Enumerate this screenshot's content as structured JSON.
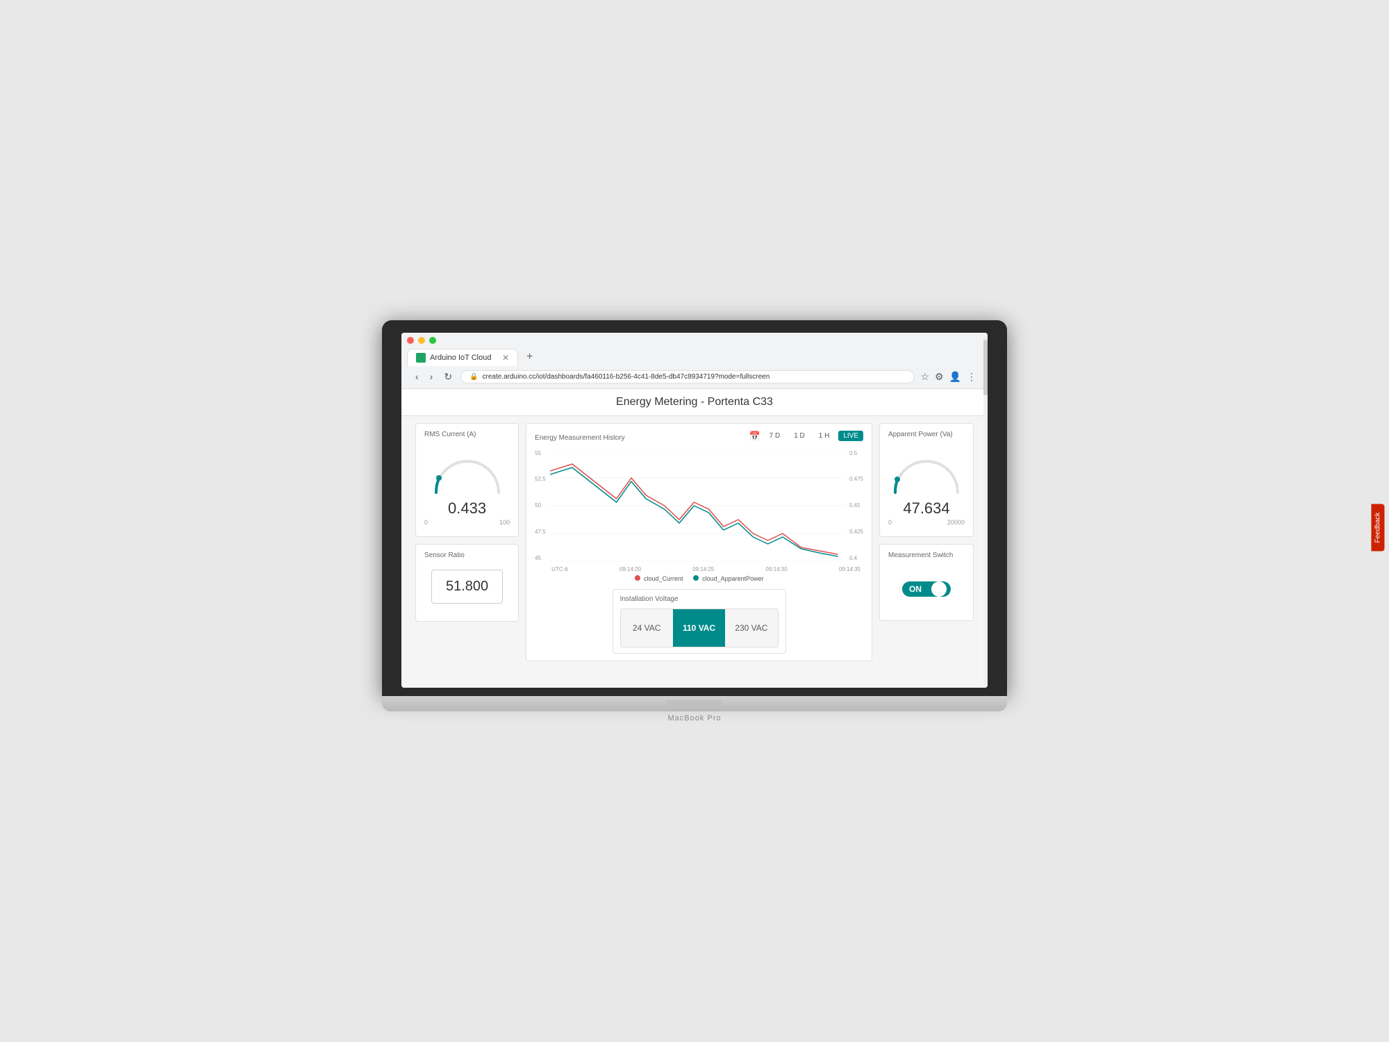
{
  "laptop": {
    "label": "MacBook Pro"
  },
  "browser": {
    "tab_title": "Arduino IoT Cloud",
    "url": "create.arduino.cc/iot/dashboards/fa460116-b256-4c41-8de5-db47c8934719?mode=fullscreen",
    "new_tab_icon": "+"
  },
  "dashboard": {
    "title": "Energy Metering - Portenta C33",
    "rms_current": {
      "label": "RMS Current (A)",
      "value": "0.433",
      "min": "0",
      "max": "100"
    },
    "sensor_ratio": {
      "label": "Sensor Ratio",
      "value": "51.800"
    },
    "energy_chart": {
      "label": "Energy Measurement History",
      "timezone": "UTC-6",
      "buttons": [
        "7 D",
        "1 D",
        "1 H",
        "LIVE"
      ],
      "active_button": "LIVE",
      "x_labels": [
        "09:14:20",
        "09:14:25",
        "09:14:30",
        "09:14:35"
      ],
      "y_left_labels": [
        "55",
        "52.5",
        "50",
        "47.5",
        "45"
      ],
      "y_right_labels": [
        "0.5",
        "0.475",
        "0.45",
        "0.425",
        "0.4"
      ],
      "legend": [
        {
          "label": "cloud_Current",
          "color": "#e05050"
        },
        {
          "label": "cloud_ApparentPower",
          "color": "#008b8b"
        }
      ]
    },
    "apparent_power": {
      "label": "Apparent Power (Va)",
      "value": "47.634",
      "min": "0",
      "max": "20000"
    },
    "measurement_switch": {
      "label": "Measurement Switch",
      "state": "ON",
      "is_on": true
    },
    "installation_voltage": {
      "label": "Installation Voltage",
      "options": [
        "24 VAC",
        "110 VAC",
        "230 VAC"
      ],
      "active": "110 VAC"
    }
  },
  "feedback": {
    "label": "Feedback"
  }
}
